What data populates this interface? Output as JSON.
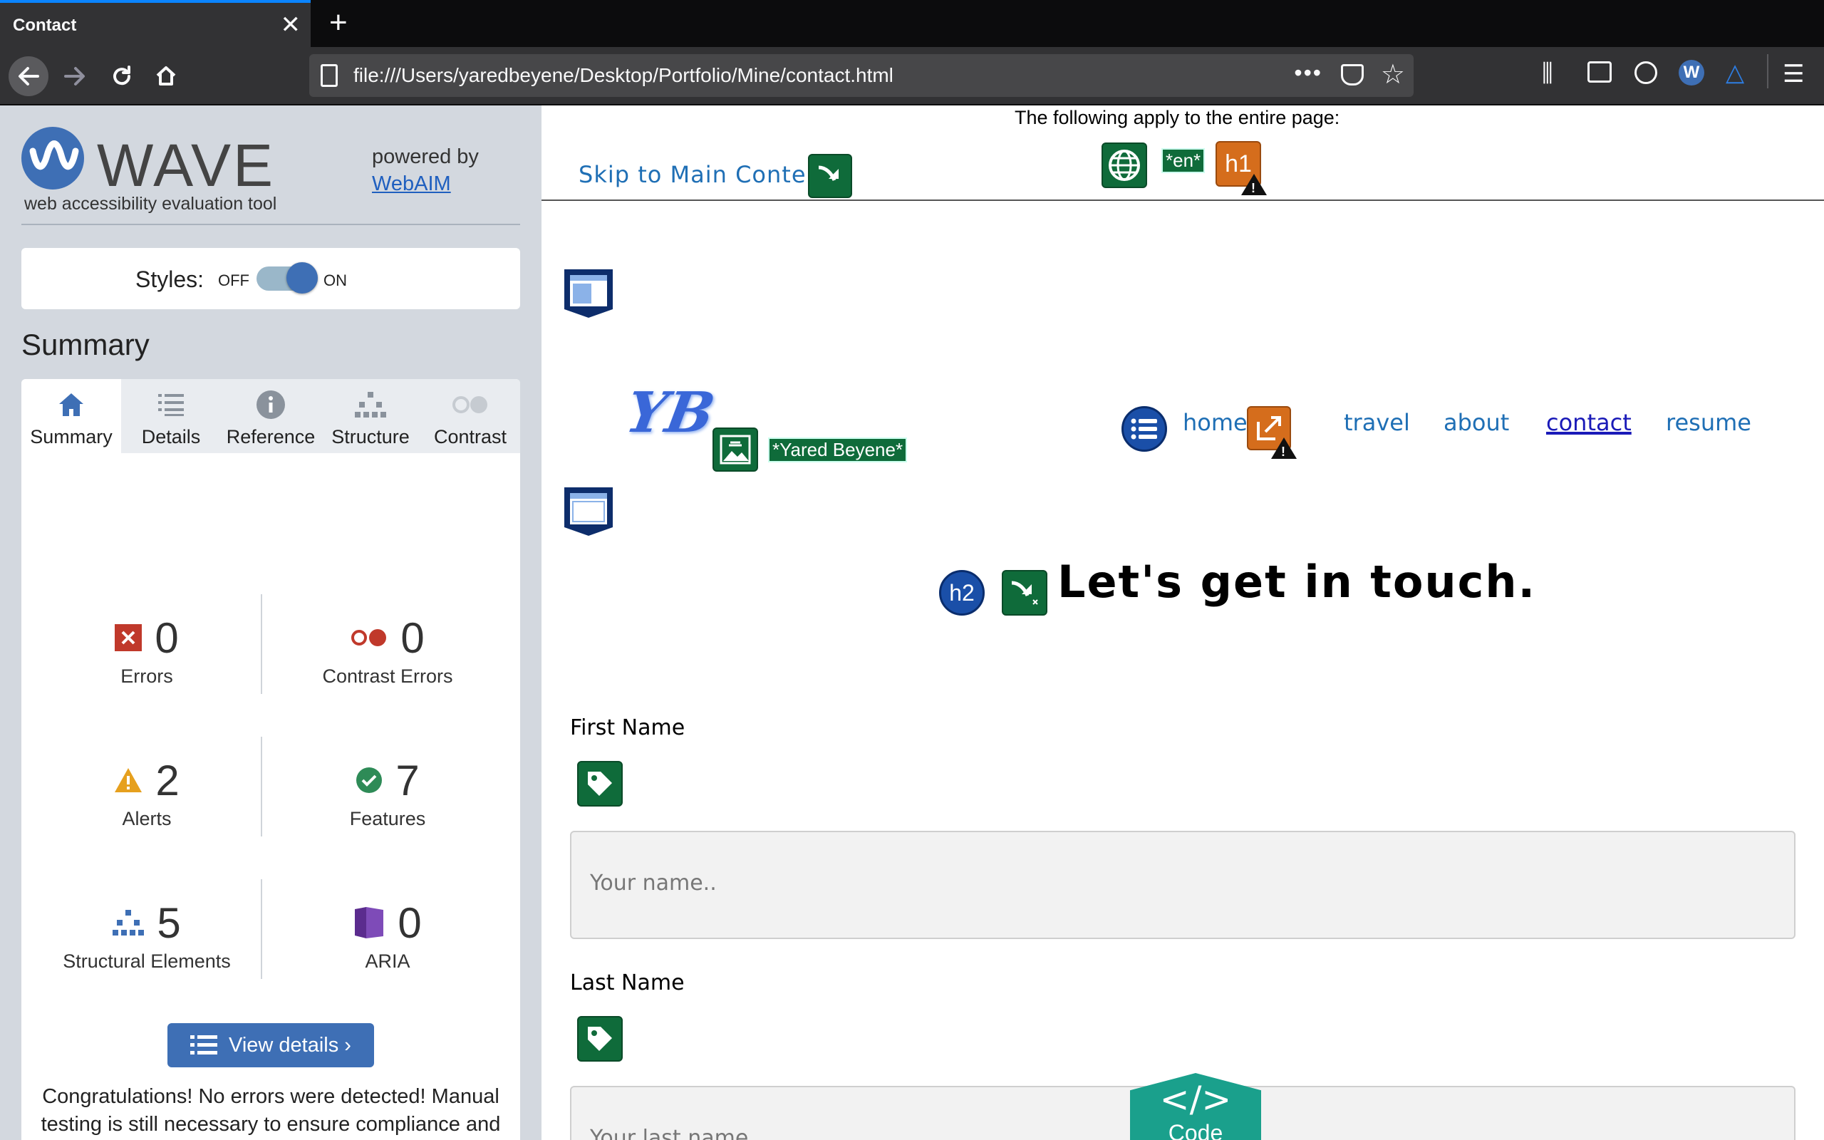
{
  "browser": {
    "tab_title": "Contact",
    "tab_close": "✕",
    "new_tab": "+",
    "url": "file:///Users/yaredbeyene/Desktop/Portfolio/Mine/contact.html",
    "url_more": "•••"
  },
  "wave": {
    "wordmark": "WAVE",
    "tagline": "web accessibility evaluation tool",
    "powered_by": "powered by",
    "webaim": "WebAIM",
    "styles_label": "Styles:",
    "styles_off": "OFF",
    "styles_on": "ON",
    "styles_state": "on",
    "summary_heading": "Summary",
    "tabs": [
      {
        "label": "Summary",
        "icon": "home-icon",
        "active": true
      },
      {
        "label": "Details",
        "icon": "list-icon"
      },
      {
        "label": "Reference",
        "icon": "info-icon"
      },
      {
        "label": "Structure",
        "icon": "structure-icon"
      },
      {
        "label": "Contrast",
        "icon": "contrast-icon"
      }
    ],
    "stats": {
      "errors": {
        "count": "0",
        "label": "Errors",
        "color": "#c0392b"
      },
      "contrast_errors": {
        "count": "0",
        "label": "Contrast Errors",
        "color": "#c0392b"
      },
      "alerts": {
        "count": "2",
        "label": "Alerts",
        "color": "#e6a01e"
      },
      "features": {
        "count": "7",
        "label": "Features",
        "color": "#2e8b57"
      },
      "structural": {
        "count": "5",
        "label": "Structural Elements",
        "color": "#3e6fb5"
      },
      "aria": {
        "count": "0",
        "label": "ARIA",
        "color": "#5b2c8e"
      }
    },
    "view_details": "View details ›",
    "congrats": "Congratulations! No errors were detected! Manual testing is still necessary to ensure compliance and optimal accessibility."
  },
  "page": {
    "applies_text": "The following apply to the entire page:",
    "lang_tag": "*en*",
    "h1_badge": "h1",
    "skip_link": "Skip to Main Content",
    "logo_text": "YB",
    "alt_tag": "*Yared Beyene*",
    "nav": [
      "home",
      "travel",
      "about",
      "contact",
      "resume"
    ],
    "active_nav": "contact",
    "h2_badge": "h2",
    "heading": "Let's get in touch.",
    "first_name_label": "First Name",
    "first_name_placeholder": "Your name..",
    "last_name_label": "Last Name",
    "last_name_placeholder": "Your last name..",
    "code_glyph": "</>",
    "code_label": "Code"
  }
}
